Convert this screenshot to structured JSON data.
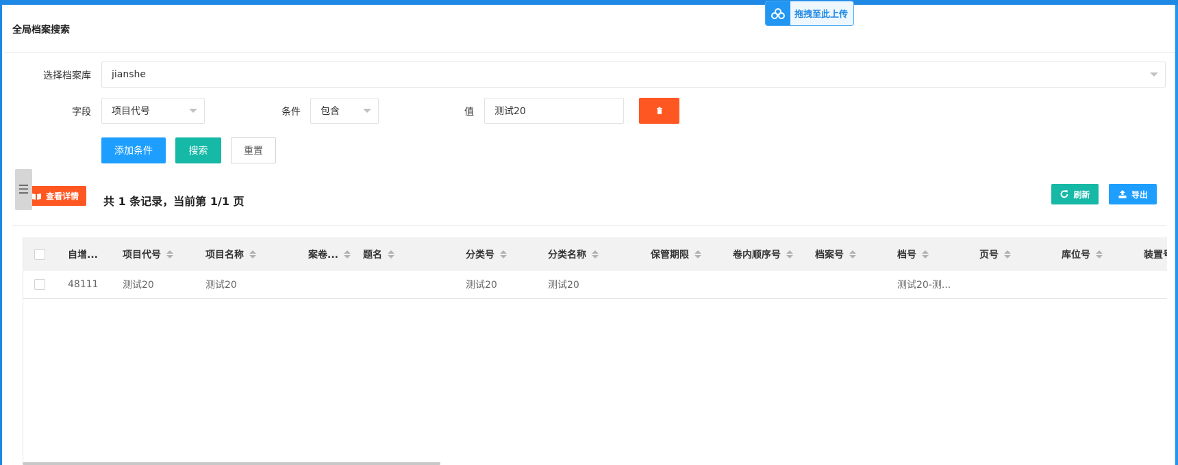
{
  "upload_float": {
    "label": "拖拽至此上传"
  },
  "page": {
    "title": "全局档案搜索"
  },
  "form": {
    "archive_label": "选择档案库",
    "archive_value": "jianshe",
    "field_label": "字段",
    "field_value": "项目代号",
    "condition_label": "条件",
    "condition_value": "包含",
    "value_label": "值",
    "value_input": "测试20",
    "add_condition": "添加条件",
    "search": "搜索",
    "reset": "重置"
  },
  "toolbar": {
    "detail": "查看详情",
    "record_info": "共 1 条记录，当前第 1/1 页",
    "refresh": "刷新",
    "export": "导出"
  },
  "table": {
    "headers": [
      "自增...",
      "项目代号",
      "项目名称",
      "案卷...",
      "题名",
      "分类号",
      "分类名称",
      "保管期限",
      "卷内顺序号",
      "档案号",
      "档号",
      "页号",
      "库位号",
      "装置号"
    ],
    "rows": [
      [
        "48111",
        "测试20",
        "测试20",
        "",
        "",
        "测试20",
        "测试20",
        "",
        "",
        "",
        "测试20-测...",
        "",
        "",
        ""
      ]
    ]
  },
  "colors": {
    "primary": "#1e9fff",
    "teal": "#16b8a6",
    "danger": "#ff5722",
    "topbar": "#1e88e5"
  }
}
